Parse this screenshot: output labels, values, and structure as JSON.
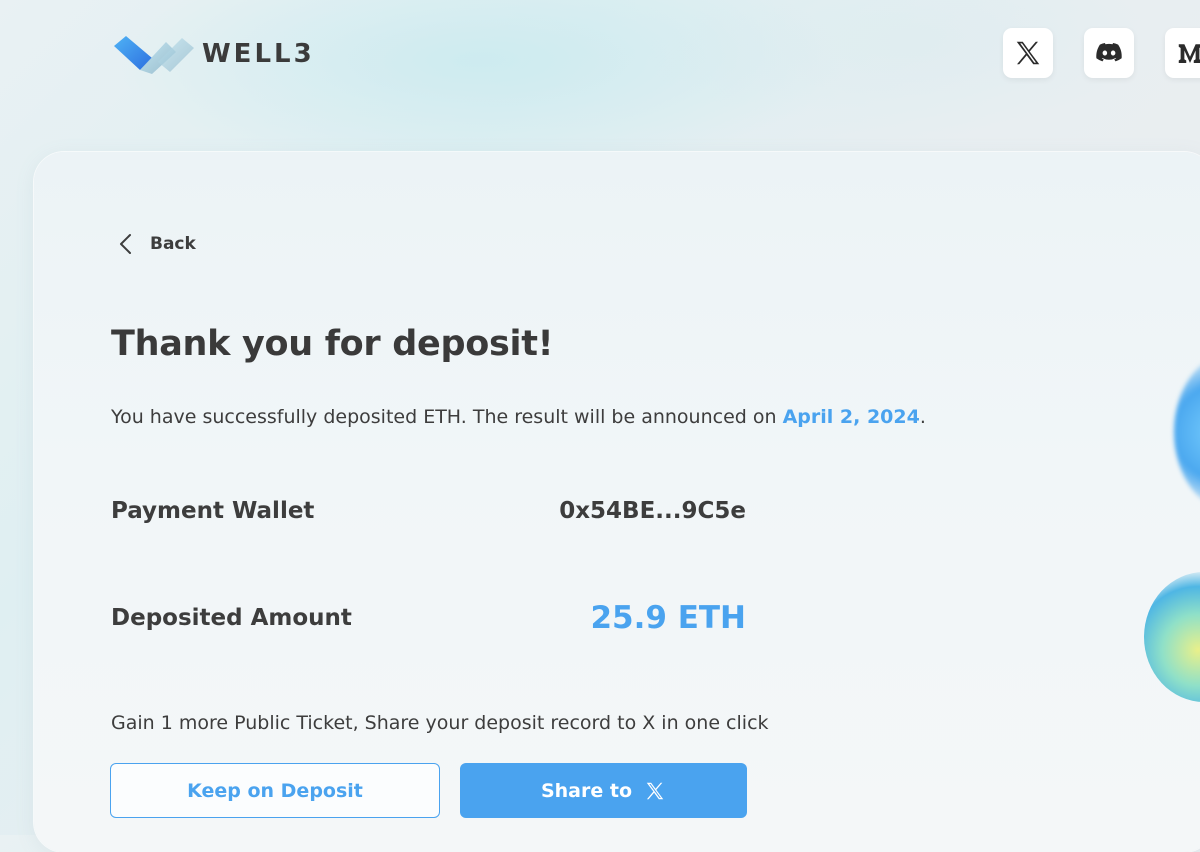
{
  "header": {
    "brand": "WELL3",
    "social": [
      {
        "name": "x-icon"
      },
      {
        "name": "discord-icon"
      },
      {
        "name": "medium-icon"
      }
    ]
  },
  "nav": {
    "back_label": "Back"
  },
  "main": {
    "title": "Thank you for deposit!",
    "desc_prefix": "You have successfully deposited ETH. The result will be announced on ",
    "announce_date": "April 2, 2024",
    "desc_suffix": ".",
    "wallet_label": "Payment Wallet",
    "wallet_value": "0x54BE...9C5e",
    "amount_label": "Deposited Amount",
    "amount_value": "25.9 ETH",
    "gain_text": "Gain 1 more Public Ticket, Share your deposit record to X in one click"
  },
  "buttons": {
    "keep_label": "Keep on Deposit",
    "share_label": "Share to"
  },
  "colors": {
    "accent": "#4aa3ef",
    "text": "#3d3d3d"
  }
}
